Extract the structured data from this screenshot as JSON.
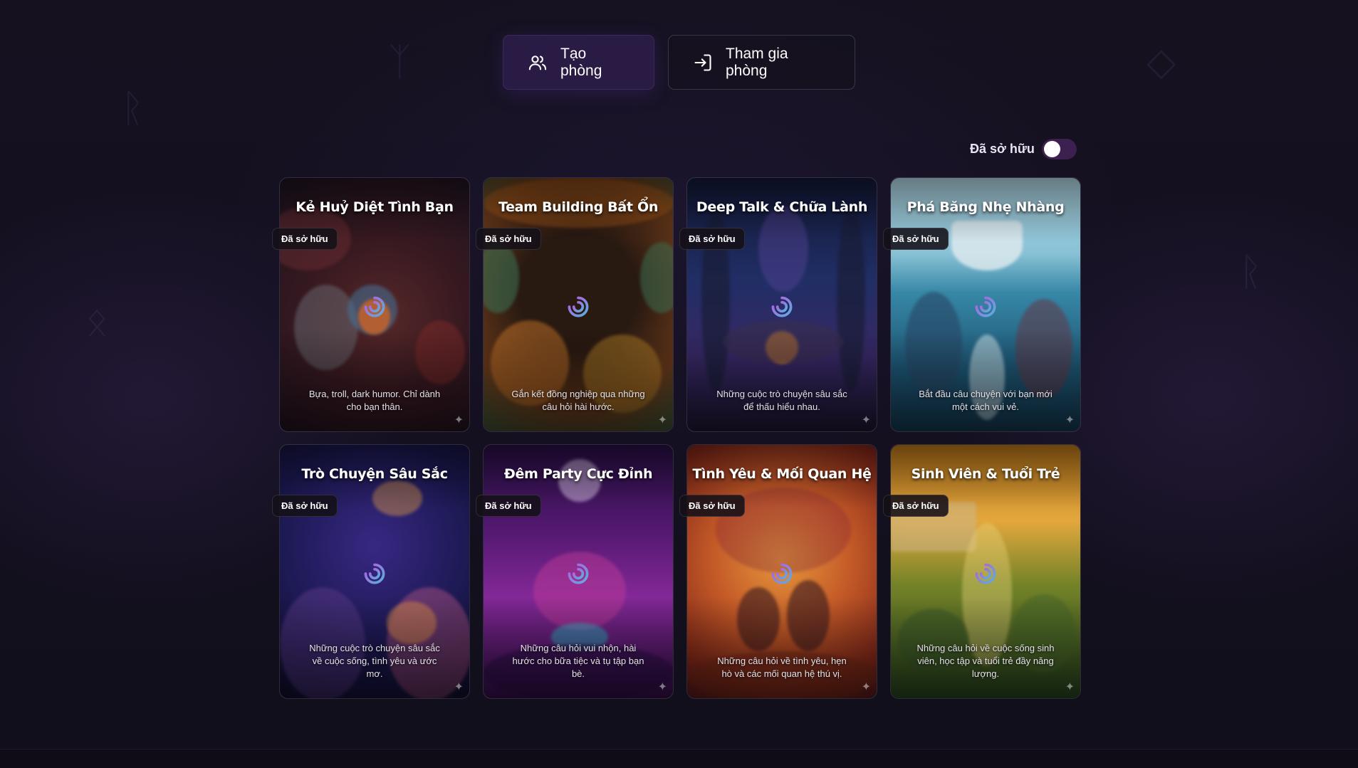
{
  "actions": {
    "create_label": "Tạo phòng",
    "join_label": "Tham gia phòng"
  },
  "filter": {
    "owned_label": "Đã sở hữu",
    "owned_on": false
  },
  "cards": [
    {
      "title": "Kẻ Huỷ Diệt Tình Bạn",
      "badge": "Đã sở hữu",
      "description": "Bựa, troll, dark humor. Chỉ dành cho bạn thân.",
      "art_icons": [
        "skull",
        "flame-creature"
      ],
      "colors": [
        "#3a1a22",
        "#7a2a2a",
        "#c4472c",
        "#1c1320"
      ]
    },
    {
      "title": "Team Building Bất Ổn",
      "badge": "Đã sở hữu",
      "description": "Gắn kết đồng nghiệp qua những câu hỏi hài hước.",
      "art_icons": [
        "cartoon-people"
      ],
      "colors": [
        "#2a1a12",
        "#c86a1c",
        "#3f7a5a",
        "#241410"
      ]
    },
    {
      "title": "Deep Talk & Chữa Lành",
      "badge": "Đã sở hữu",
      "description": "Những cuộc trò chuyện sâu sắc để thấu hiểu nhau.",
      "art_icons": [
        "campfire",
        "forest"
      ],
      "colors": [
        "#101a3c",
        "#2b3a7a",
        "#6b4fb0",
        "#e08a3a"
      ]
    },
    {
      "title": "Phá Băng Nhẹ Nhàng",
      "badge": "Đã sở hữu",
      "description": "Bắt đầu câu chuyện với bạn mới một cách vui vẻ.",
      "art_icons": [
        "iceberg",
        "two-people"
      ],
      "colors": [
        "#9fd3e6",
        "#3a8fb0",
        "#1e5a7a",
        "#d8eef5"
      ]
    },
    {
      "title": "Trò Chuyện Sâu Sắc",
      "badge": "Đã sở hữu",
      "description": "Những cuộc trò chuyện sâu sắc về cuộc sống, tình yêu và ước mơ.",
      "art_icons": [
        "brain",
        "speech-bubble"
      ],
      "colors": [
        "#1a1850",
        "#3a2a8a",
        "#c05a8a",
        "#e8a04a"
      ]
    },
    {
      "title": "Đêm Party Cực Đỉnh",
      "badge": "Đã sở hữu",
      "description": "Những câu hỏi vui nhộn, hài hước cho bữa tiệc và tụ tập bạn bè.",
      "art_icons": [
        "disco-ball",
        "dj"
      ],
      "colors": [
        "#2a0f48",
        "#8a2aa0",
        "#d040a0",
        "#20d0d0"
      ]
    },
    {
      "title": "Tình Yêu & Mối Quan Hệ",
      "badge": "Đã sở hữu",
      "description": "Những câu hỏi về tình yêu, hẹn hò và các mối quan hệ thú vị.",
      "art_icons": [
        "couple",
        "planet"
      ],
      "colors": [
        "#8a2a1a",
        "#d0602a",
        "#f0a040",
        "#5a1a20"
      ]
    },
    {
      "title": "Sinh Viên & Tuổi Trẻ",
      "badge": "Đã sở hữu",
      "description": "Những câu hỏi về cuộc sống sinh viên, học tập và tuổi trẻ đầy năng lượng.",
      "art_icons": [
        "university",
        "students"
      ],
      "colors": [
        "#2a4a20",
        "#5a8a2a",
        "#f0b040",
        "#c07a1a"
      ]
    }
  ]
}
